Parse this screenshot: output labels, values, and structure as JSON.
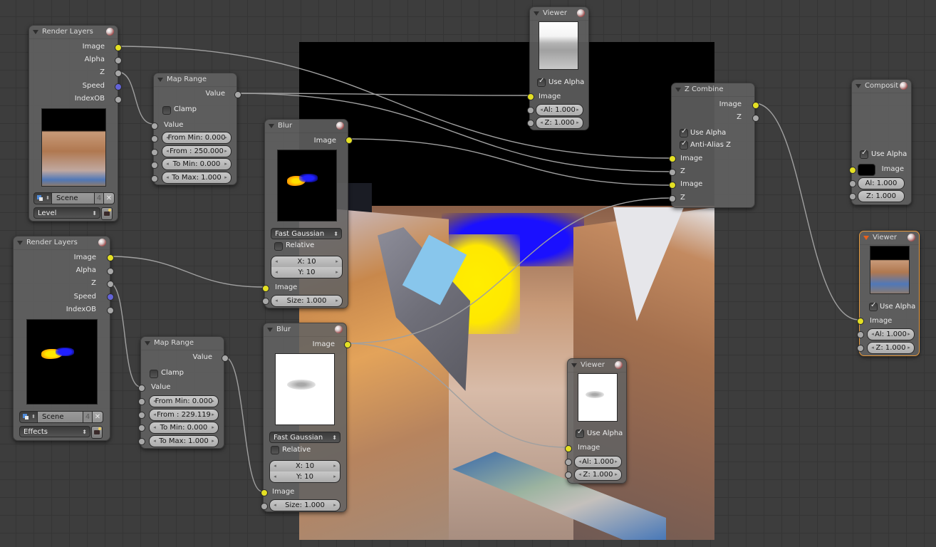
{
  "editor": {
    "type": "Compositor node editor",
    "backdrop": true
  },
  "colors": {
    "background": "#3d3d3d",
    "grid": "#353535",
    "node_body": "#626262",
    "socket_image": "#e4e024",
    "socket_value": "#a8a8a8",
    "socket_vector": "#6464d8",
    "active_node_border": "#e89a3c",
    "wire": "#a0a0a0"
  },
  "nodes": {
    "render_layers_1": {
      "title": "Render Layers",
      "outputs": [
        "Image",
        "Alpha",
        "Z",
        "Speed",
        "IndexOB"
      ],
      "scene": "Scene",
      "scene_users": "4",
      "layer": "Level"
    },
    "map_range_1": {
      "title": "Map Range",
      "output": "Value",
      "clamp_label": "Clamp",
      "clamp": false,
      "input_label": "Value",
      "fields": [
        "From Min: 0.000",
        "From : 250.000",
        "To Min: 0.000",
        "To Max: 1.000"
      ]
    },
    "blur_1": {
      "title": "Blur",
      "output": "Image",
      "filter": "Fast Gaussian",
      "relative_label": "Relative",
      "relative": false,
      "x": "X: 10",
      "y": "Y: 10",
      "input_label": "Image",
      "size": "Size: 1.000"
    },
    "viewer_1": {
      "title": "Viewer",
      "use_alpha_label": "Use Alpha",
      "use_alpha": true,
      "input_label": "Image",
      "alpha": "Al: 1.000",
      "z": "Z: 1.000"
    },
    "z_combine": {
      "title": "Z Combine",
      "outputs": [
        "Image",
        "Z"
      ],
      "use_alpha_label": "Use Alpha",
      "use_alpha": true,
      "antialias_label": "Anti-Alias Z",
      "antialias": true,
      "inputs": [
        "Image",
        "Z",
        "Image",
        "Z"
      ]
    },
    "composite": {
      "title": "Composit",
      "use_alpha_label": "Use Alpha",
      "use_alpha": true,
      "input_label": "Image",
      "alpha": "Al: 1.000",
      "z": "Z: 1.000"
    },
    "viewer_active": {
      "title": "Viewer",
      "use_alpha_label": "Use Alpha",
      "use_alpha": true,
      "input_label": "Image",
      "alpha": "Al: 1.000",
      "z": "Z: 1.000"
    },
    "render_layers_2": {
      "title": "Render Layers",
      "outputs": [
        "Image",
        "Alpha",
        "Z",
        "Speed",
        "IndexOB"
      ],
      "scene": "Scene",
      "scene_users": "4",
      "layer": "Effects"
    },
    "map_range_2": {
      "title": "Map Range",
      "output": "Value",
      "clamp_label": "Clamp",
      "clamp": false,
      "input_label": "Value",
      "fields": [
        "From Min: 0.000",
        "From : 229.119",
        "To Min: 0.000",
        "To Max: 1.000"
      ]
    },
    "blur_2": {
      "title": "Blur",
      "output": "Image",
      "filter": "Fast Gaussian",
      "relative_label": "Relative",
      "relative": false,
      "x": "X: 10",
      "y": "Y: 10",
      "input_label": "Image",
      "size": "Size: 1.000"
    },
    "viewer_2": {
      "title": "Viewer",
      "use_alpha_label": "Use Alpha",
      "use_alpha": true,
      "input_label": "Image",
      "alpha": "Al: 1.000",
      "z": "Z: 1.000"
    }
  },
  "icons": {
    "collapse": "triangle-down-icon",
    "preview_toggle": "material-ball-icon",
    "scene_browse": "scene-icon",
    "unlink": "x-icon",
    "render": "camera-icon",
    "spinner": "updown-arrows-icon",
    "field_dec": "◂",
    "field_inc": "▸",
    "updown": "⬍"
  }
}
